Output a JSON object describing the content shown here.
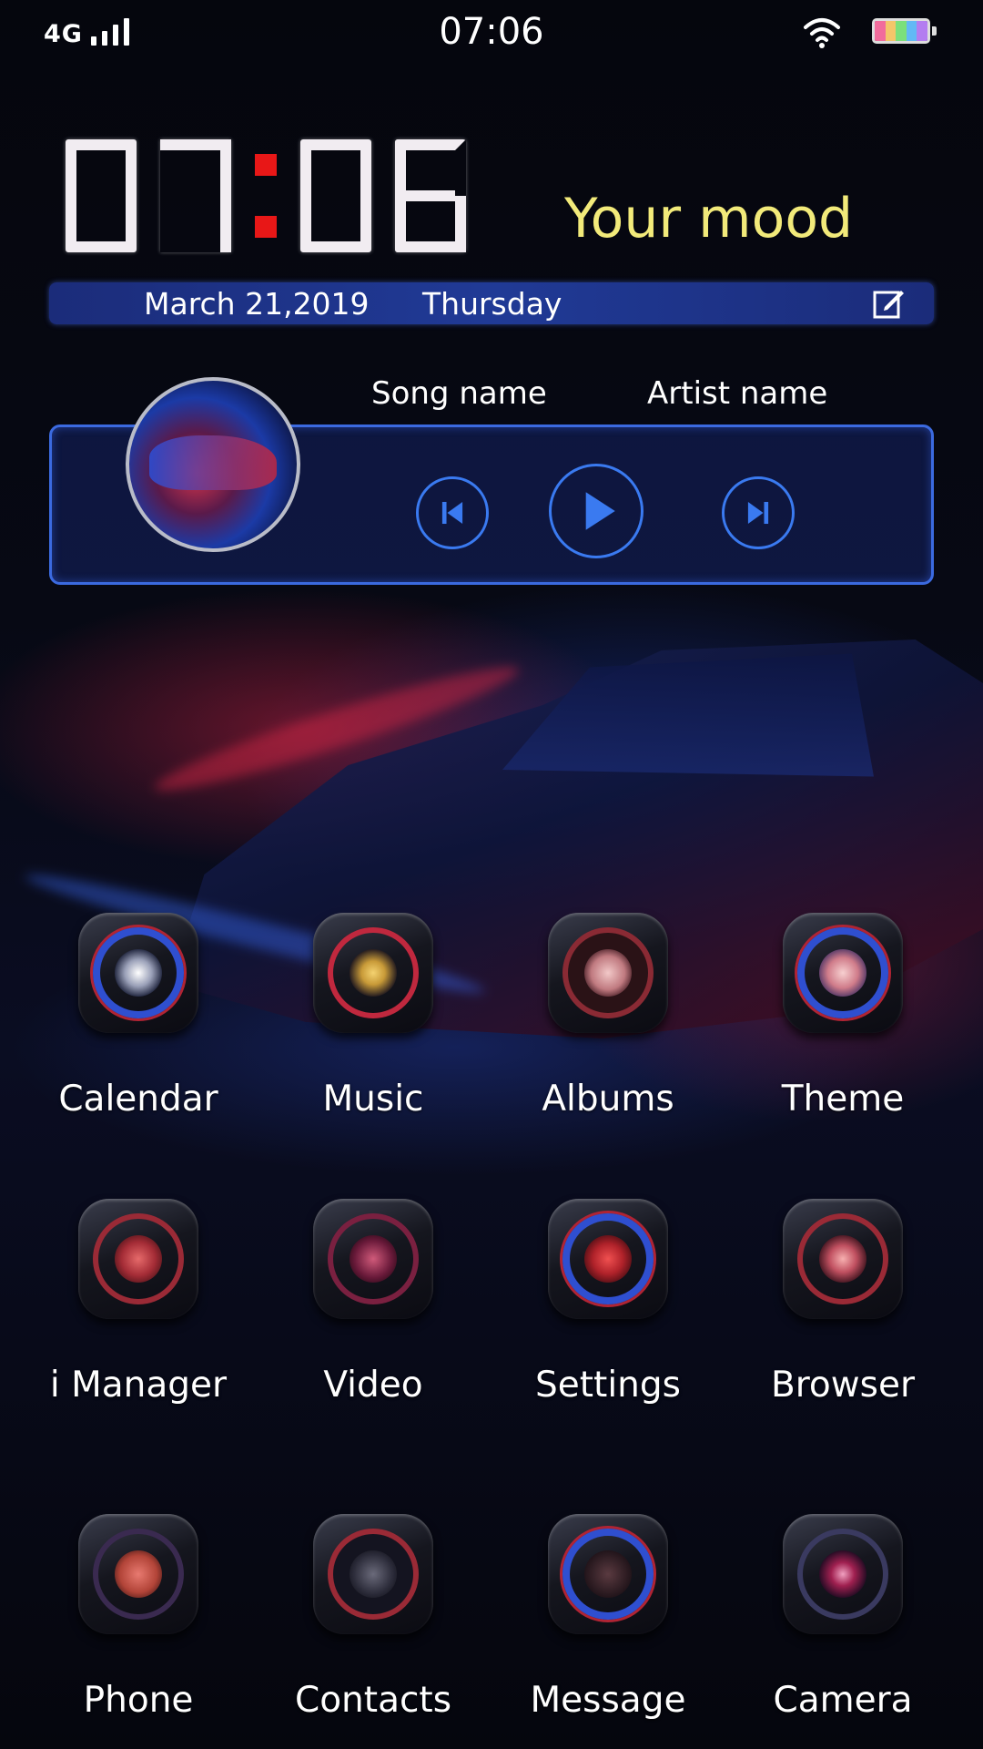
{
  "status_bar": {
    "network": "4G",
    "time": "07:06"
  },
  "clock_widget": {
    "time": "07:06",
    "mood": "Your mood",
    "date": "March 21,2019",
    "weekday": "Thursday",
    "edit_icon": "edit-icon"
  },
  "music_widget": {
    "song_name": "Song name",
    "artist_name": "Artist name",
    "controls": [
      "previous-icon",
      "play-icon",
      "next-icon"
    ]
  },
  "apps": [
    {
      "label": "Calendar",
      "icon": "calendar-icon"
    },
    {
      "label": "Music",
      "icon": "music-icon"
    },
    {
      "label": "Albums",
      "icon": "albums-icon"
    },
    {
      "label": "Theme",
      "icon": "theme-icon"
    },
    {
      "label": "i Manager",
      "icon": "imanager-icon"
    },
    {
      "label": "Video",
      "icon": "video-icon"
    },
    {
      "label": "Settings",
      "icon": "settings-icon"
    },
    {
      "label": "Browser",
      "icon": "browser-icon"
    },
    {
      "label": "Phone",
      "icon": "phone-icon"
    },
    {
      "label": "Contacts",
      "icon": "contacts-icon"
    },
    {
      "label": "Message",
      "icon": "message-icon"
    },
    {
      "label": "Camera",
      "icon": "camera-icon"
    }
  ],
  "colors": {
    "accent_blue": "#3a7af0",
    "clock_colon": "#e81717",
    "mood_text": "#f2ea7a",
    "date_bar": "#203a96"
  }
}
